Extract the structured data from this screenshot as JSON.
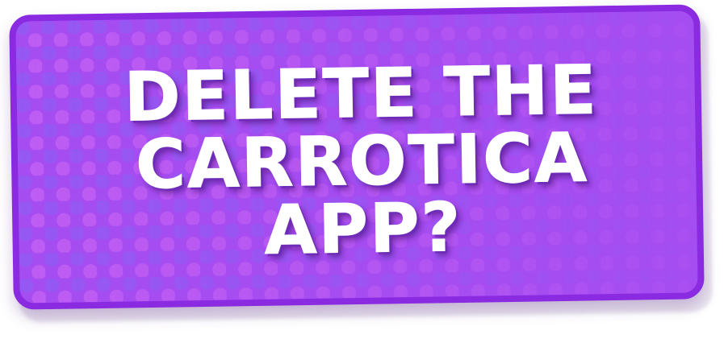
{
  "dialog": {
    "line1": "DELETE THE",
    "line2": "CARROTICA",
    "line3": "APP?"
  },
  "colors": {
    "card_fill": "#a64df2",
    "card_border": "#8a2be2",
    "dot_blue": "#7a5cf0",
    "dot_pink": "#c75cf0",
    "text": "#ffffff"
  }
}
